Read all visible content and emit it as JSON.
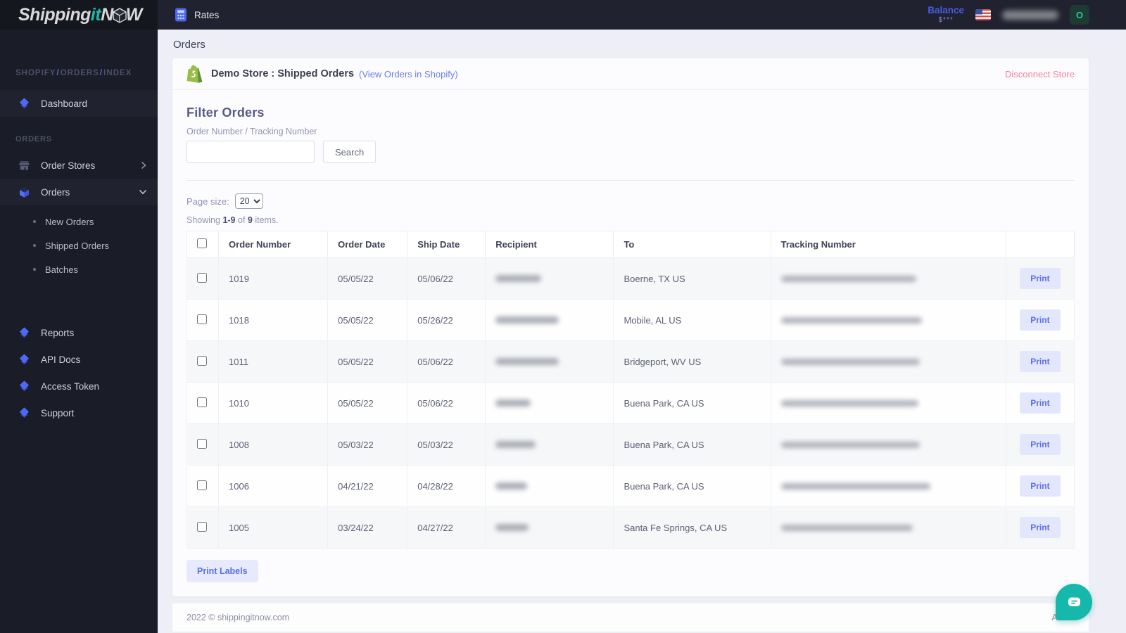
{
  "topbar": {
    "logo": {
      "shipping": "Shipping",
      "it": "it",
      "n": "N",
      "w": "W"
    },
    "rates_label": "Rates",
    "balance_label": "Balance",
    "balance_value": "$***",
    "username_redacted": true,
    "avatar_letter": "O"
  },
  "sidebar": {
    "breadcrumb": {
      "parts": [
        "SHOPIFY",
        "ORDERS",
        "INDEX"
      ],
      "separator": "/"
    },
    "items": [
      {
        "type": "link",
        "icon": "diamond-icon",
        "label": "Dashboard",
        "active": true
      },
      {
        "type": "section",
        "label": "ORDERS"
      },
      {
        "type": "link",
        "icon": "storefront-icon",
        "label": "Order Stores",
        "chevron": "right"
      },
      {
        "type": "link",
        "icon": "cube-icon",
        "label": "Orders",
        "chevron": "down",
        "active": true,
        "children": [
          {
            "label": "New Orders"
          },
          {
            "label": "Shipped Orders"
          },
          {
            "label": "Batches"
          }
        ]
      },
      {
        "type": "gap"
      },
      {
        "type": "link",
        "icon": "diamond-icon",
        "label": "Reports"
      },
      {
        "type": "link",
        "icon": "diamond-icon",
        "label": "API Docs"
      },
      {
        "type": "link",
        "icon": "diamond-icon",
        "label": "Access Token"
      },
      {
        "type": "link",
        "icon": "diamond-icon",
        "label": "Support"
      }
    ]
  },
  "main": {
    "page_title": "Orders",
    "store_bar": {
      "store_name": "Demo Store : Shipped Orders",
      "view_link": "(View Orders in Shopify)",
      "disconnect_label": "Disconnect Store"
    },
    "filter": {
      "heading": "Filter Orders",
      "field_label": "Order Number / Tracking Number",
      "input_value": "",
      "search_label": "Search"
    },
    "list": {
      "page_size_label": "Page size:",
      "page_size_value": "20",
      "showing": {
        "prefix": "Showing",
        "range": "1-9",
        "middle": "of",
        "total": "9",
        "suffix": "items."
      }
    },
    "table": {
      "columns": [
        "",
        "Order Number",
        "Order Date",
        "Ship Date",
        "Recipient",
        "To",
        "Tracking Number",
        ""
      ],
      "print_label": "Print",
      "rows": [
        {
          "order_number": "1019",
          "order_date": "05/05/22",
          "ship_date": "05/06/22",
          "recipient_redacted": true,
          "recipient_blur_width": 65,
          "to": "Boerne, TX US",
          "tracking_redacted": true,
          "tracking_blur_width": 192
        },
        {
          "order_number": "1018",
          "order_date": "05/05/22",
          "ship_date": "05/26/22",
          "recipient_redacted": true,
          "recipient_blur_width": 90,
          "to": "Mobile, AL US",
          "tracking_redacted": true,
          "tracking_blur_width": 200
        },
        {
          "order_number": "1011",
          "order_date": "05/05/22",
          "ship_date": "05/06/22",
          "recipient_redacted": true,
          "recipient_blur_width": 90,
          "to": "Bridgeport, WV US",
          "tracking_redacted": true,
          "tracking_blur_width": 197
        },
        {
          "order_number": "1010",
          "order_date": "05/05/22",
          "ship_date": "05/06/22",
          "recipient_redacted": true,
          "recipient_blur_width": 50,
          "to": "Buena Park, CA US",
          "tracking_redacted": true,
          "tracking_blur_width": 195
        },
        {
          "order_number": "1008",
          "order_date": "05/03/22",
          "ship_date": "05/03/22",
          "recipient_redacted": true,
          "recipient_blur_width": 57,
          "to": "Buena Park, CA US",
          "tracking_redacted": true,
          "tracking_blur_width": 197
        },
        {
          "order_number": "1006",
          "order_date": "04/21/22",
          "ship_date": "04/28/22",
          "recipient_redacted": true,
          "recipient_blur_width": 45,
          "to": "Buena Park, CA US",
          "tracking_redacted": true,
          "tracking_blur_width": 212
        },
        {
          "order_number": "1005",
          "order_date": "03/24/22",
          "ship_date": "04/27/22",
          "recipient_redacted": true,
          "recipient_blur_width": 47,
          "to": "Santa Fe Springs, CA US",
          "tracking_redacted": true,
          "tracking_blur_width": 187
        }
      ]
    },
    "print_labels_label": "Print Labels"
  },
  "footer": {
    "copyright": "2022 © shippingitnow.com",
    "about_label": "About"
  },
  "colors": {
    "accent": "#5c6fe6",
    "sidebar_bg": "#1a1c28",
    "topbar_bg": "#20222f",
    "teal": "#16b8ab",
    "disconnect_pink": "#f8819b",
    "shopify_green": "#95bf47",
    "balance_blue": "#4a5be2"
  }
}
